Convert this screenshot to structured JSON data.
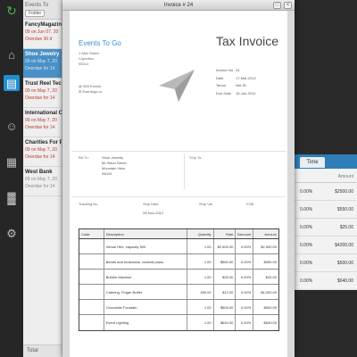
{
  "sidebar": {
    "icons": [
      {
        "name": "app-logo-icon",
        "glyph": "↻"
      },
      {
        "name": "home-icon",
        "glyph": "⌂"
      },
      {
        "name": "invoices-icon",
        "glyph": "▤"
      },
      {
        "name": "clients-icon",
        "glyph": "☺"
      },
      {
        "name": "cart-icon",
        "glyph": "▦"
      },
      {
        "name": "reports-icon",
        "glyph": "▓"
      },
      {
        "name": "settings-icon",
        "glyph": "⚙"
      }
    ]
  },
  "list": {
    "title": "Events To",
    "filter_label": "Folder",
    "items": [
      {
        "name": "FancyMagazine",
        "line1": "09 on Jun 07, 20",
        "line2": "Overdue 30 d",
        "state": "overdue"
      },
      {
        "name": "Shoe Jewelry",
        "line1": "09 on May 7, 20",
        "line2": "Overdue for 14",
        "state": "active"
      },
      {
        "name": "Trust Reel Tech",
        "line1": "09 on May 7, 20",
        "line2": "Overdue for 14",
        "state": "overdue"
      },
      {
        "name": "International Co",
        "line1": "09 on May 7, 20",
        "line2": "Overdue for 14",
        "state": "overdue"
      },
      {
        "name": "Charities For Pr",
        "line1": "09 on May 7, 20",
        "line2": "Overdue for 14",
        "state": "overdue"
      },
      {
        "name": "West Bank",
        "line1": "09 on May 7, 20",
        "line2": "Overdue for 14",
        "state": "normal"
      }
    ],
    "footer": "Total"
  },
  "window": {
    "title": "Invoice # 24",
    "print_glyph": "□",
    "close_glyph": "×"
  },
  "invoice": {
    "company": "Events To Go",
    "address_lines": [
      "1 Alex Street",
      "Cupertino",
      "95014"
    ],
    "contact_lines": [
      "@ 555 Events",
      "✉ Eventsgo.co"
    ],
    "doc_title": "Tax Invoice",
    "meta": [
      {
        "label": "Invoice No",
        "value": "24"
      },
      {
        "label": "Date",
        "value": "17-Mar-2012"
      },
      {
        "label": "Terms",
        "value": "Net 30"
      },
      {
        "label": "Due Date",
        "value": "16-Jun-2012"
      }
    ],
    "bill_to_label": "Bill To:",
    "bill_to_lines": [
      "Shoe Jewelry",
      "56 Sitton Street",
      "Mountain View",
      "94043"
    ],
    "ship_to_label": "Ship To:",
    "shipping": {
      "tracking_label": "Tracking No",
      "ship_date_label": "Ship Date",
      "ship_via_label": "Ship Via",
      "fob_label": "FOB",
      "ship_date_value": "28-Nov-2012"
    },
    "columns": {
      "code": "Code",
      "description": "Description",
      "quantity": "Quantity",
      "rate": "Rate",
      "discount": "Discount",
      "amount": "Amount"
    },
    "items": [
      {
        "code": "",
        "description": "Venue Hire, capacity 500",
        "quantity": "1.00",
        "rate": "$2,500.00",
        "discount": "0.00%",
        "amount": "$2,500.00"
      },
      {
        "code": "",
        "description": "Bands and musicians, cocktail piano",
        "quantity": "1.00",
        "rate": "$550.00",
        "discount": "0.00%",
        "amount": "$550.00"
      },
      {
        "code": "",
        "description": "Bubble Machine",
        "quantity": "1.00",
        "rate": "$25.00",
        "discount": "0.00%",
        "amount": "$25.00"
      },
      {
        "code": "",
        "description": "Catering, Finger Buffet",
        "quantity": "350.00",
        "rate": "$12.00",
        "discount": "0.00%",
        "amount": "$4,200.00"
      },
      {
        "code": "",
        "description": "Chocolate Fountain",
        "quantity": "1.00",
        "rate": "$500.00",
        "discount": "0.00%",
        "amount": "$500.00"
      },
      {
        "code": "",
        "description": "Event Lighting",
        "quantity": "1.00",
        "rate": "$640.00",
        "discount": "0.00%",
        "amount": "$640.00"
      }
    ]
  },
  "background_table": {
    "tab_label": "Time",
    "amount_header": "Amount",
    "rows": [
      {
        "pct": "0.00%",
        "amount": "$2500.00"
      },
      {
        "pct": "0.00%",
        "amount": "$550.00"
      },
      {
        "pct": "0.00%",
        "amount": "$25.00"
      },
      {
        "pct": "0.00%",
        "amount": "$4200.00"
      },
      {
        "pct": "0.00%",
        "amount": "$500.00"
      },
      {
        "pct": "0.00%",
        "amount": "$640.00"
      }
    ]
  },
  "colors": {
    "accent": "#1f8fd1",
    "company": "#3a8fd0",
    "overdue": "#c0392b"
  }
}
